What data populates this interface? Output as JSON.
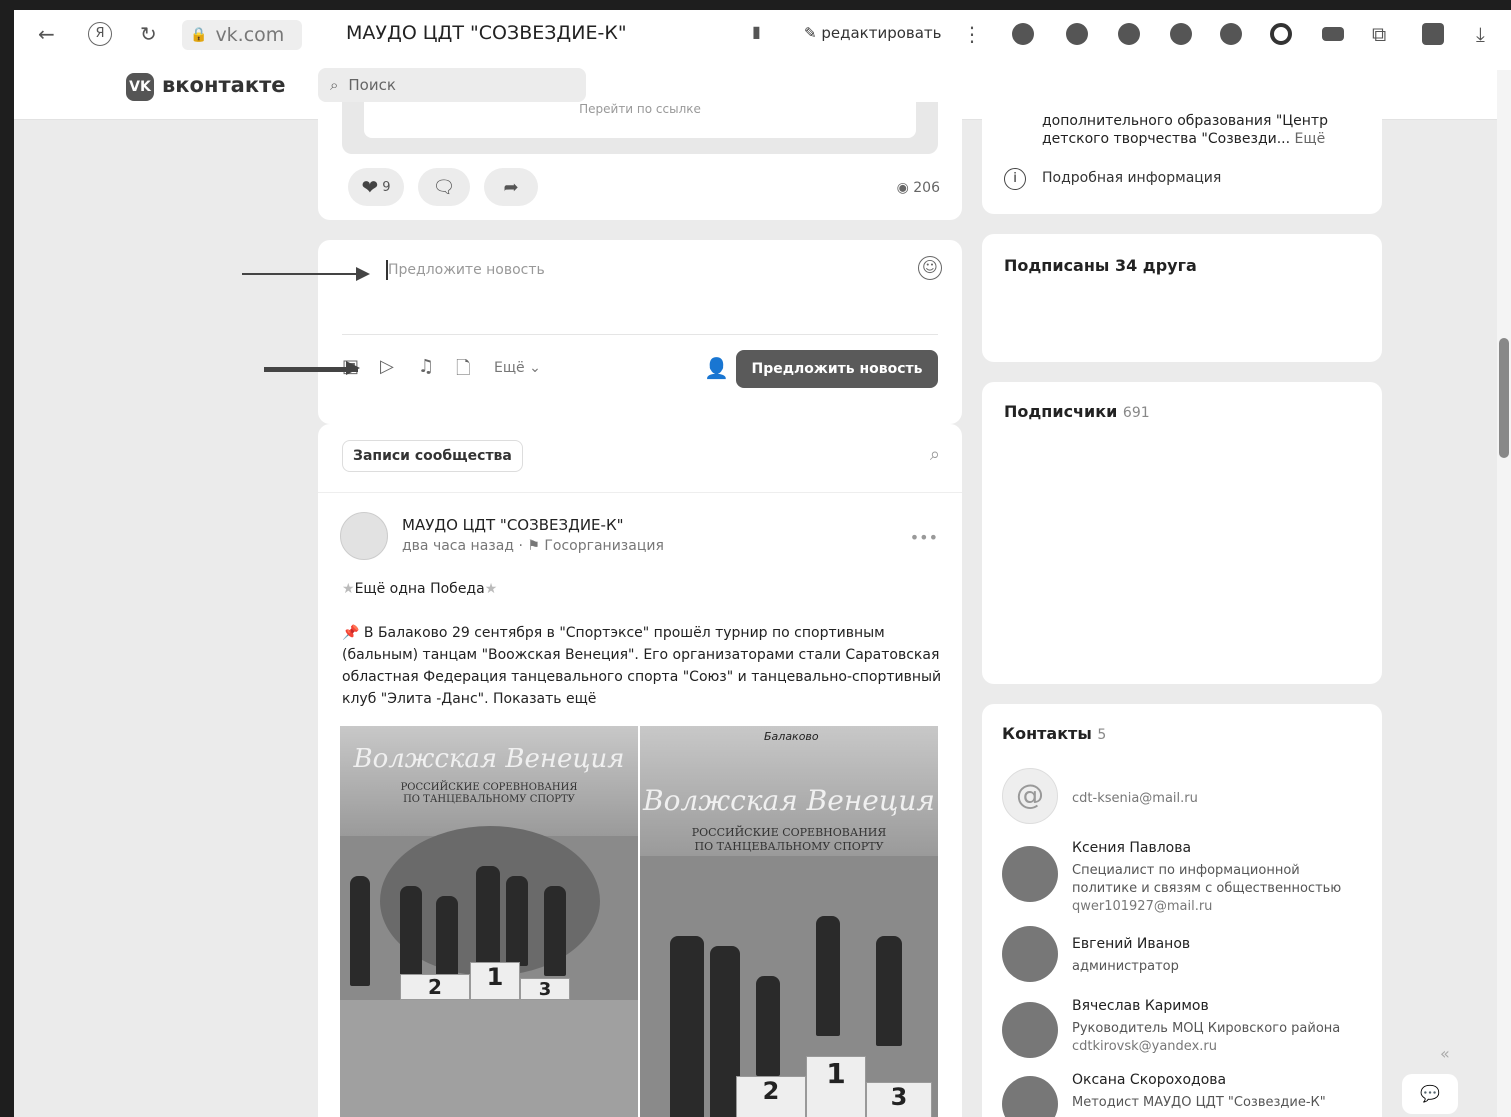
{
  "browser": {
    "url": "vk.com",
    "tab_title": "МАУДО ЦДТ \"СОЗВЕЗДИЕ-К\"",
    "edit_label": "редактировать",
    "icons": [
      "back-icon",
      "yandex-icon",
      "reload-icon",
      "lock-icon",
      "bookmark-icon",
      "edit-icon",
      "more-icon",
      "download-icon"
    ]
  },
  "vk": {
    "logo_text": "вконтакте",
    "search_placeholder": "Поиск"
  },
  "post_footer": {
    "likes": "9",
    "views": "206",
    "partial_caption": "Перейти по ссылке"
  },
  "suggest": {
    "placeholder": "Предложите новость",
    "more_label": "Ещё",
    "submit_label": "Предложить новость"
  },
  "feed": {
    "tab_label": "Записи сообщества",
    "post": {
      "author": "МАУДО ЦДТ \"СОЗВЕЗДИЕ-К\"",
      "time": "два часа назад",
      "org_type": "Госорганизация",
      "headline": "Ещё одна Победа",
      "line1": "В Балаково 29 сентября в \"Спортэксе\" прошёл турнир по спортивным",
      "line2": "(бальным) танцам \"Воожская Венеция\". Его организаторами стали Саратовская",
      "line3": "областная Федерация танцевального спорта \"Союз\" и танцевально-спортивный",
      "line4": "клуб \"Элита -Данс\".",
      "show_more": "Показать ещё",
      "photo1_title": "Волжская Венеция",
      "photo1_sub1": "РОССИЙСКИЕ СОРЕВНОВАНИЯ",
      "photo1_sub2": "ПО ТАНЦЕВАЛЬНОМУ СПОРТУ",
      "photo2_title": "Волжская Венеция",
      "photo2_sub1": "РОССИЙСКИЕ СОРЕВНОВАНИЯ",
      "photo2_sub2": "ПО ТАНЦЕВАЛЬНОМУ СПОРТУ",
      "photo2_city": "Балаково",
      "podium": [
        "2",
        "1",
        "3"
      ]
    }
  },
  "right": {
    "about_line1": "дополнительного образования \"Центр",
    "about_line2": "детского творчества \"Созвезди...",
    "about_more": "Ещё",
    "info_label": "Подробная информация",
    "friends_label": "Подписаны 34 друга",
    "subscribers_label": "Подписчики",
    "subscribers_count": "691",
    "contacts_label": "Контакты",
    "contacts_count": "5",
    "contacts": [
      {
        "name": "",
        "line1": "cdt-ksenia@mail.ru",
        "line2": "",
        "line3": ""
      },
      {
        "name": "Ксения Павлова",
        "line1": "Специалист по информационной",
        "line2": "политике и связям с общественностью",
        "line3": "qwer101927@mail.ru"
      },
      {
        "name": "Евгений Иванов",
        "line1": "администратор",
        "line2": "",
        "line3": ""
      },
      {
        "name": "Вячеслав Каримов",
        "line1": "Руководитель МОЦ Кировского района",
        "line2": "cdtkirovsk@yandex.ru",
        "line3": ""
      },
      {
        "name": "Оксана Скороходова",
        "line1": "Методист МАУДО ЦДТ \"Созвездие-К\"",
        "line2": "",
        "line3": ""
      }
    ]
  }
}
